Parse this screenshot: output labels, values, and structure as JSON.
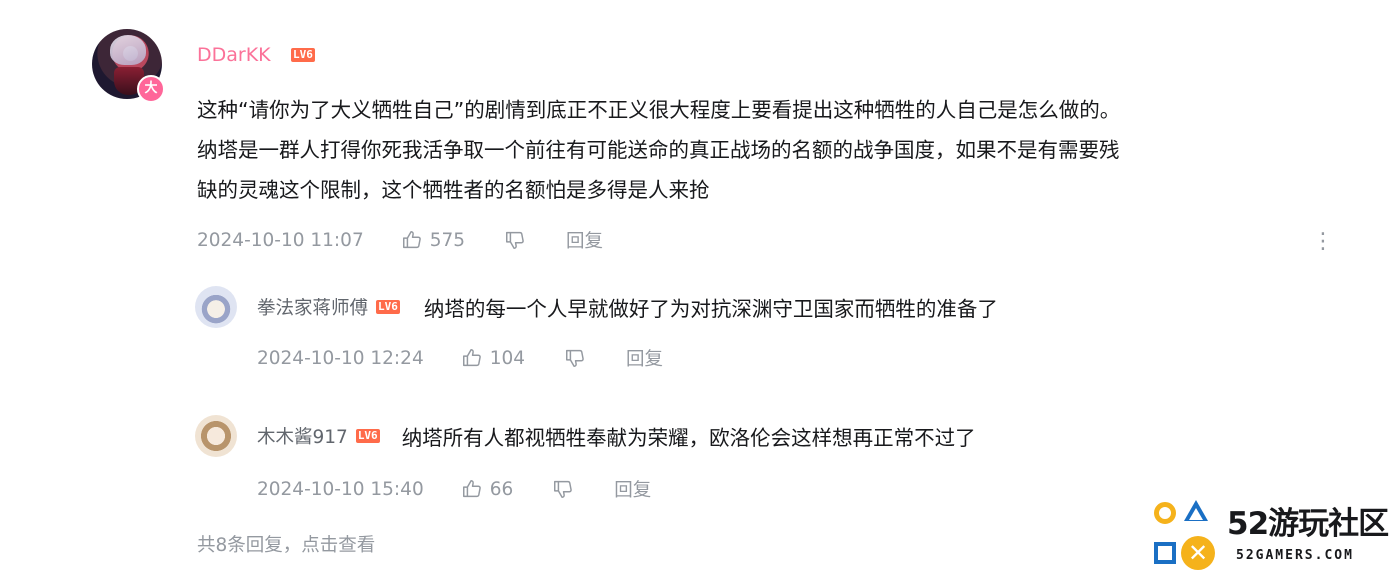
{
  "comment": {
    "username": "DDarKK",
    "level": "LV6",
    "badge": "大",
    "content": "这种“请你为了大义牺牲自己”的剧情到底正不正义很大程度上要看提出这种牺牲的人自己是怎么做的。\n纳塔是一群人打得你死我活争取一个前往有可能送命的真正战场的名额的战争国度，如果不是有需要残\n缺的灵魂这个限制，这个牺牲者的名额怕是多得是人来抢",
    "time": "2024-10-10 11:07",
    "likes": "575",
    "reply_label": "回复",
    "more_icon": "⋮"
  },
  "replies": [
    {
      "username": "拳法家蒋师傅",
      "level": "LV6",
      "content": "纳塔的每一个人早就做好了为对抗深渊守卫国家而牺牲的准备了",
      "time": "2024-10-10 12:24",
      "likes": "104",
      "reply_label": "回复"
    },
    {
      "username": "木木酱917",
      "level": "LV6",
      "content": "纳塔所有人都视牺牲奉献为荣耀，欧洛伦会这样想再正常不过了",
      "time": "2024-10-10 15:40",
      "likes": "66",
      "reply_label": "回复"
    }
  ],
  "view_more": "共8条回复，点击查看",
  "watermark": {
    "brand": "52游玩社区",
    "sub": "52GAMERS.COM",
    "colors": {
      "yellow": "#f5b21b",
      "blue": "#1a6fc4"
    }
  },
  "colors": {
    "username_vip": "#fb7299",
    "meta": "#9499a0",
    "level_badge": "#ff6b4a"
  }
}
